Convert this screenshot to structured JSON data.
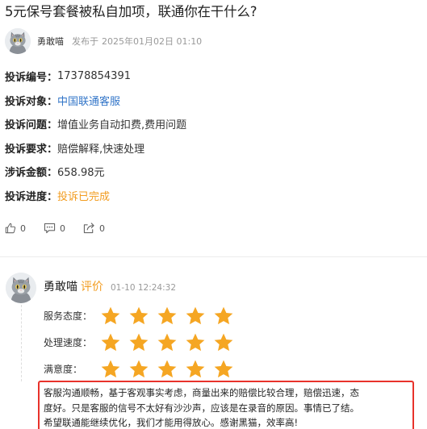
{
  "post": {
    "title": "5元保号套餐被私自加项，联通你在干什么?",
    "author": "勇敢喵",
    "publish_prefix": "发布于",
    "publish_date": "2025年01月02日 01:10"
  },
  "info": [
    {
      "label": "投诉编号：",
      "value": "17378854391",
      "style": "plain"
    },
    {
      "label": "投诉对象：",
      "value": "中国联通客服",
      "style": "link"
    },
    {
      "label": "投诉问题：",
      "value": "增值业务自动扣费,费用问题",
      "style": "plain"
    },
    {
      "label": "投诉要求：",
      "value": "赔偿解释,快速处理",
      "style": "plain"
    },
    {
      "label": "涉诉金额：",
      "value": "658.98元",
      "style": "plain"
    },
    {
      "label": "投诉进度：",
      "value": "投诉已完成",
      "style": "done"
    }
  ],
  "actions": {
    "like_count": "0",
    "comment_count": "0",
    "share_count": "0"
  },
  "review": {
    "author": "勇敢喵",
    "tag": "评价",
    "time": "01-10 12:24:32",
    "ratings": [
      {
        "label": "服务态度：",
        "stars": 5,
        "max": 5
      },
      {
        "label": "处理速度：",
        "stars": 5,
        "max": 5
      },
      {
        "label": "满意度：",
        "stars": 5,
        "max": 5
      }
    ],
    "text_lines": [
      "客服沟通顺畅，基于客观事实考虑，商量出来的赔偿比较合理，赔偿迅速，态",
      "度好。只是客服的信号不太好有沙沙声，应该是在录音的原因。事情已了结。",
      "希望联通能继续优化，我们才能用得放心。感谢黑猫，效率高!"
    ]
  },
  "colors": {
    "accent_orange": "#f29c1f",
    "link_blue": "#3275c8",
    "highlight_red": "#e8322b",
    "star": "#f5a623"
  }
}
